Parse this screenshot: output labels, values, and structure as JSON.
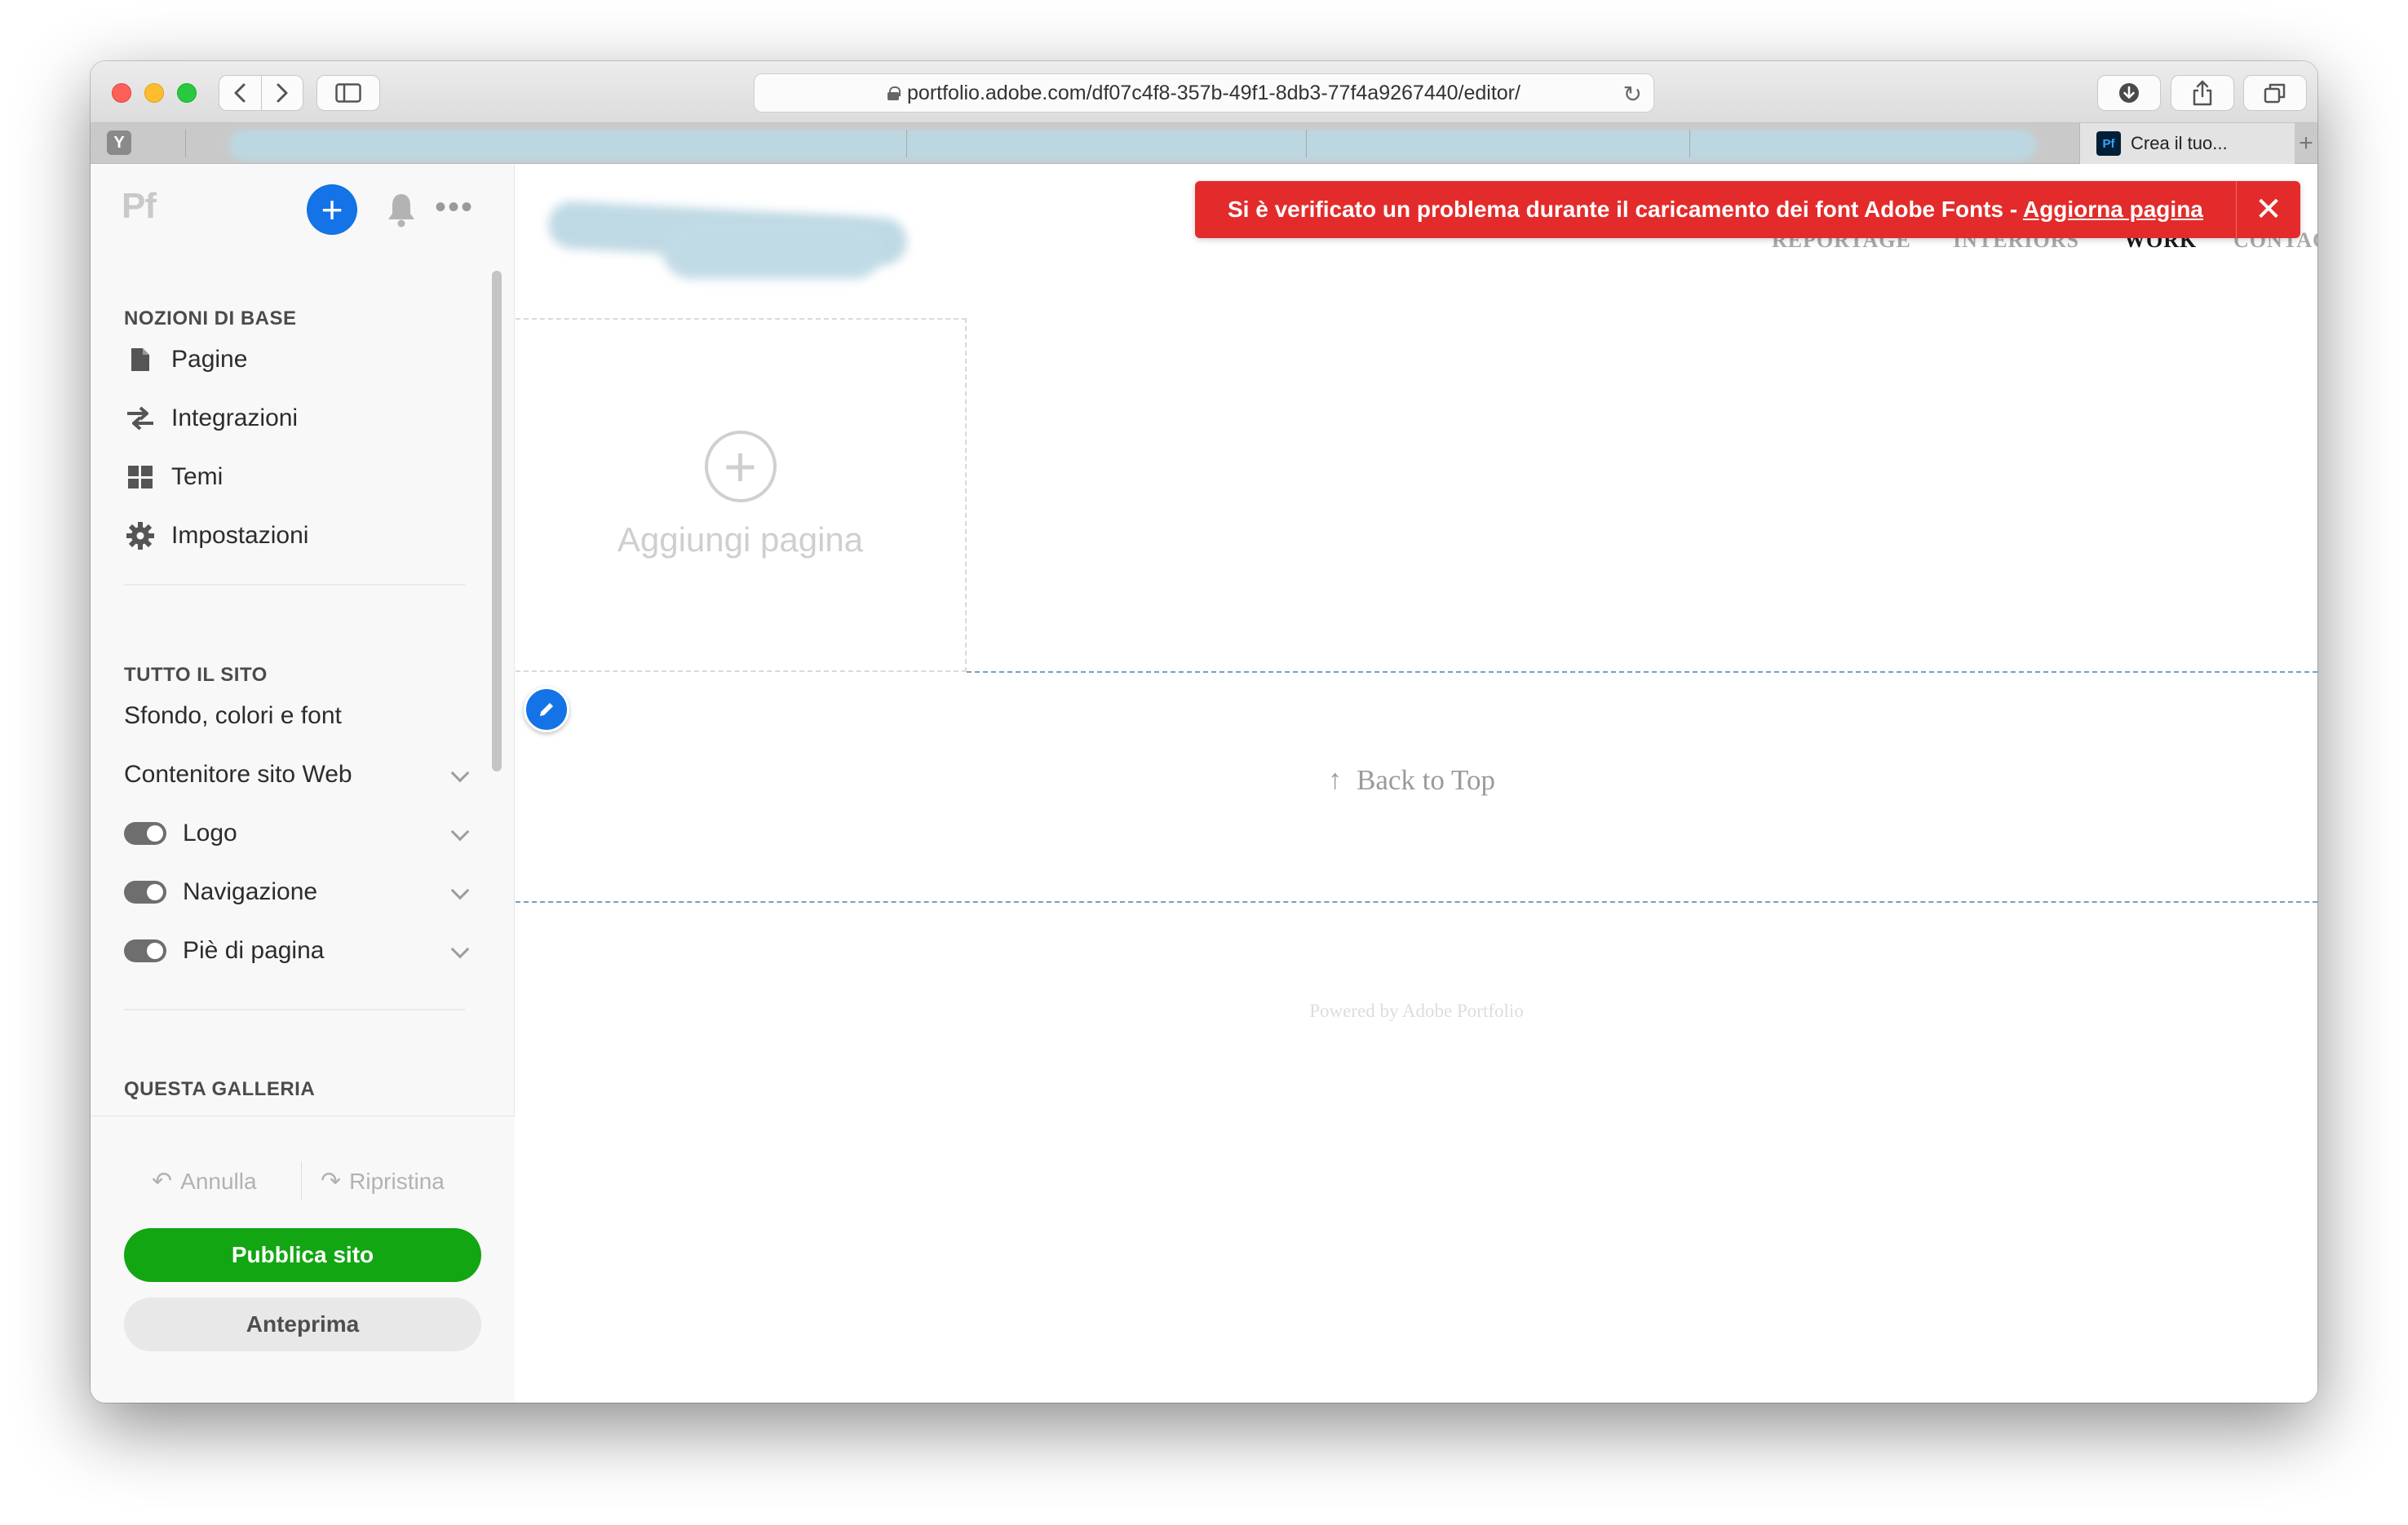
{
  "browser": {
    "url": "portfolio.adobe.com/df07c4f8-357b-49f1-8db3-77f4a9267440/editor/",
    "active_tab_title": "Crea il tuo...",
    "tab_favicon_letter": "Y",
    "active_tab_favicon": "Pf",
    "new_tab_symbol": "+"
  },
  "panel": {
    "logo": "Pf",
    "section_basics": "NOZIONI DI BASE",
    "basics_items": [
      {
        "label": "Pagine",
        "icon": "page-icon"
      },
      {
        "label": "Integrazioni",
        "icon": "integrations-icon"
      },
      {
        "label": "Temi",
        "icon": "themes-icon"
      },
      {
        "label": "Impostazioni",
        "icon": "gear-icon"
      }
    ],
    "section_site": "TUTTO IL SITO",
    "site_items": [
      {
        "label": "Sfondo, colori e font"
      },
      {
        "label": "Contenitore sito Web"
      },
      {
        "label": "Logo",
        "toggle": true
      },
      {
        "label": "Navigazione",
        "toggle": true
      },
      {
        "label": "Piè di pagina",
        "toggle": true
      }
    ],
    "section_gallery": "QUESTA GALLERIA",
    "undo": "Annulla",
    "redo": "Ripristina",
    "publish": "Pubblica sito",
    "preview": "Anteprima"
  },
  "site": {
    "nav": [
      "REPORTAGE",
      "INTERIORS",
      "WORK",
      "CONTACT"
    ],
    "active_nav": "WORK",
    "add_page": "Aggiungi pagina",
    "back_to_top": "Back to Top",
    "powered_by": "Powered by Adobe Portfolio"
  },
  "banner": {
    "message": "Si è verificato un problema durante il caricamento dei font Adobe Fonts - ",
    "link": "Aggiorna pagina",
    "close": "✕"
  },
  "colors": {
    "accent_blue": "#1473e6",
    "publish_green": "#12a612",
    "error_red": "#e32b2b"
  }
}
